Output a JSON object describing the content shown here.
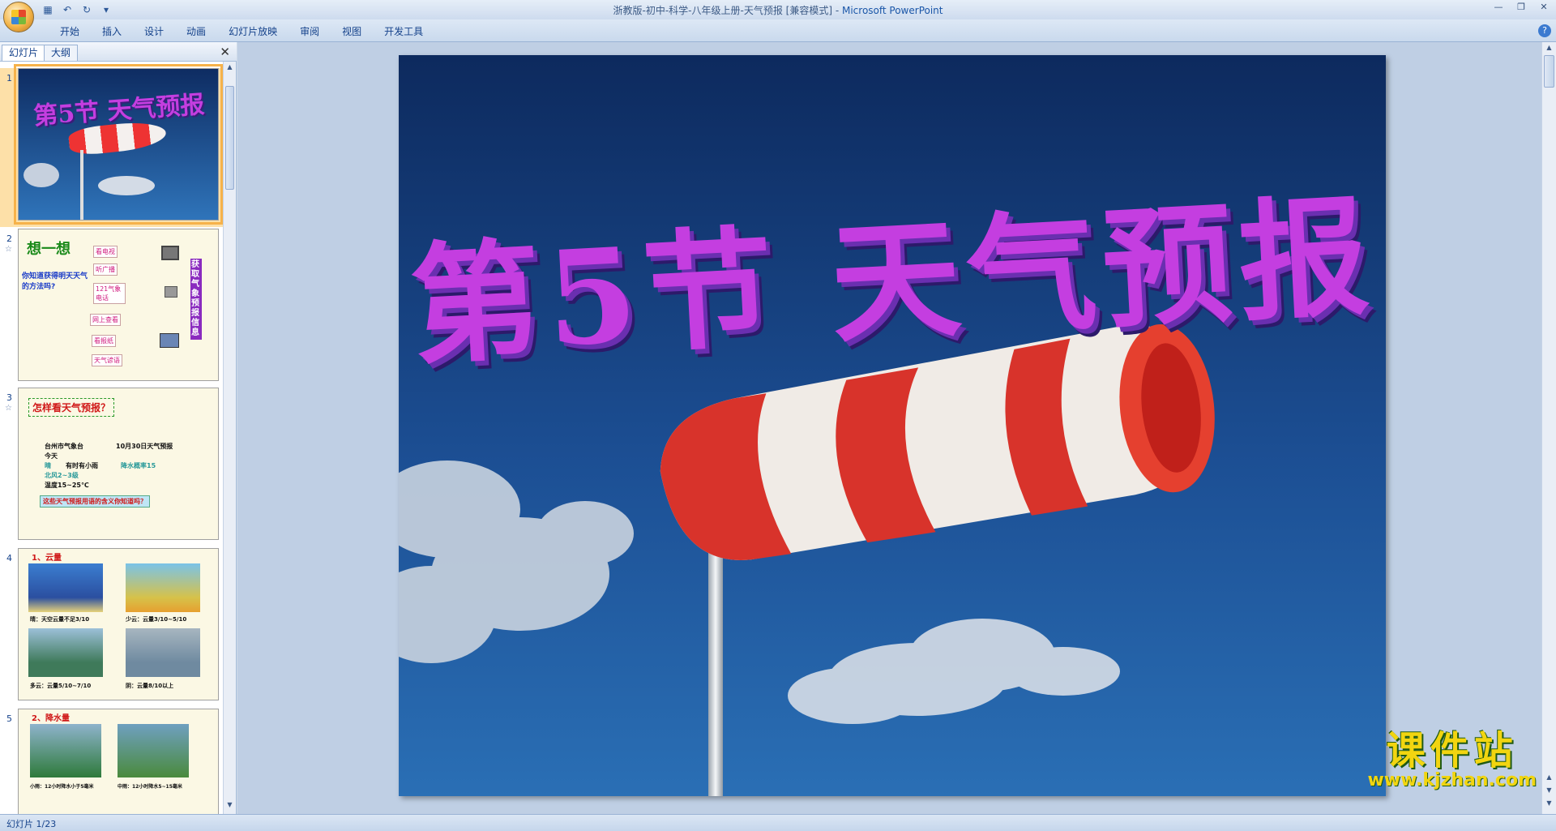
{
  "window": {
    "title": "浙教版-初中-科学-八年级上册-天气预报 [兼容模式]",
    "separator": " - ",
    "app": "Microsoft PowerPoint"
  },
  "ribbon": {
    "tabs": [
      "开始",
      "插入",
      "设计",
      "动画",
      "幻灯片放映",
      "审阅",
      "视图",
      "开发工具"
    ]
  },
  "left_pane": {
    "tabs": [
      "幻灯片",
      "大纲"
    ],
    "close_glyph": "✕"
  },
  "thumbnails": [
    {
      "num": "1",
      "title": "第5节 天气预报"
    },
    {
      "num": "2",
      "heading": "想一想",
      "question": "你知道获得明天天气的方法吗?",
      "items": [
        "看电视",
        "听广播",
        "121气象电话",
        "网上查看",
        "看报纸",
        "天气谚语"
      ],
      "side": "获取气象预报信息"
    },
    {
      "num": "3",
      "heading": "怎样看天气预报？",
      "lines": [
        "台州市气象台",
        "10月30日天气预报",
        "今天",
        "晴",
        "有时有小雨",
        "降水概率15",
        "北风2~3级",
        "温度15~25℃"
      ],
      "footer": "这些天气预报用语的含义你知道吗？"
    },
    {
      "num": "4",
      "heading": "1、云量",
      "captions": [
        "晴：天空云量不足3/10",
        "少云：云量3/10~5/10",
        "多云：云量5/10~7/10",
        "阴：云量8/10以上"
      ]
    },
    {
      "num": "5",
      "heading": "2、降水量",
      "captions": [
        "小雨：12小时降水小于5毫米",
        "中雨：12小时降水5~15毫米"
      ]
    }
  ],
  "slide": {
    "title": "第5节  天气预报"
  },
  "watermark": {
    "line1": "课件站",
    "line2": "www.kjzhan.com"
  },
  "status": {
    "slide_indicator": "幻灯片 1/23"
  },
  "colors": {
    "title_fill": "#c43ee0",
    "selection": "#f6b24a",
    "sky_top": "#0d2a5e",
    "sky_bottom": "#2a6fb5"
  }
}
